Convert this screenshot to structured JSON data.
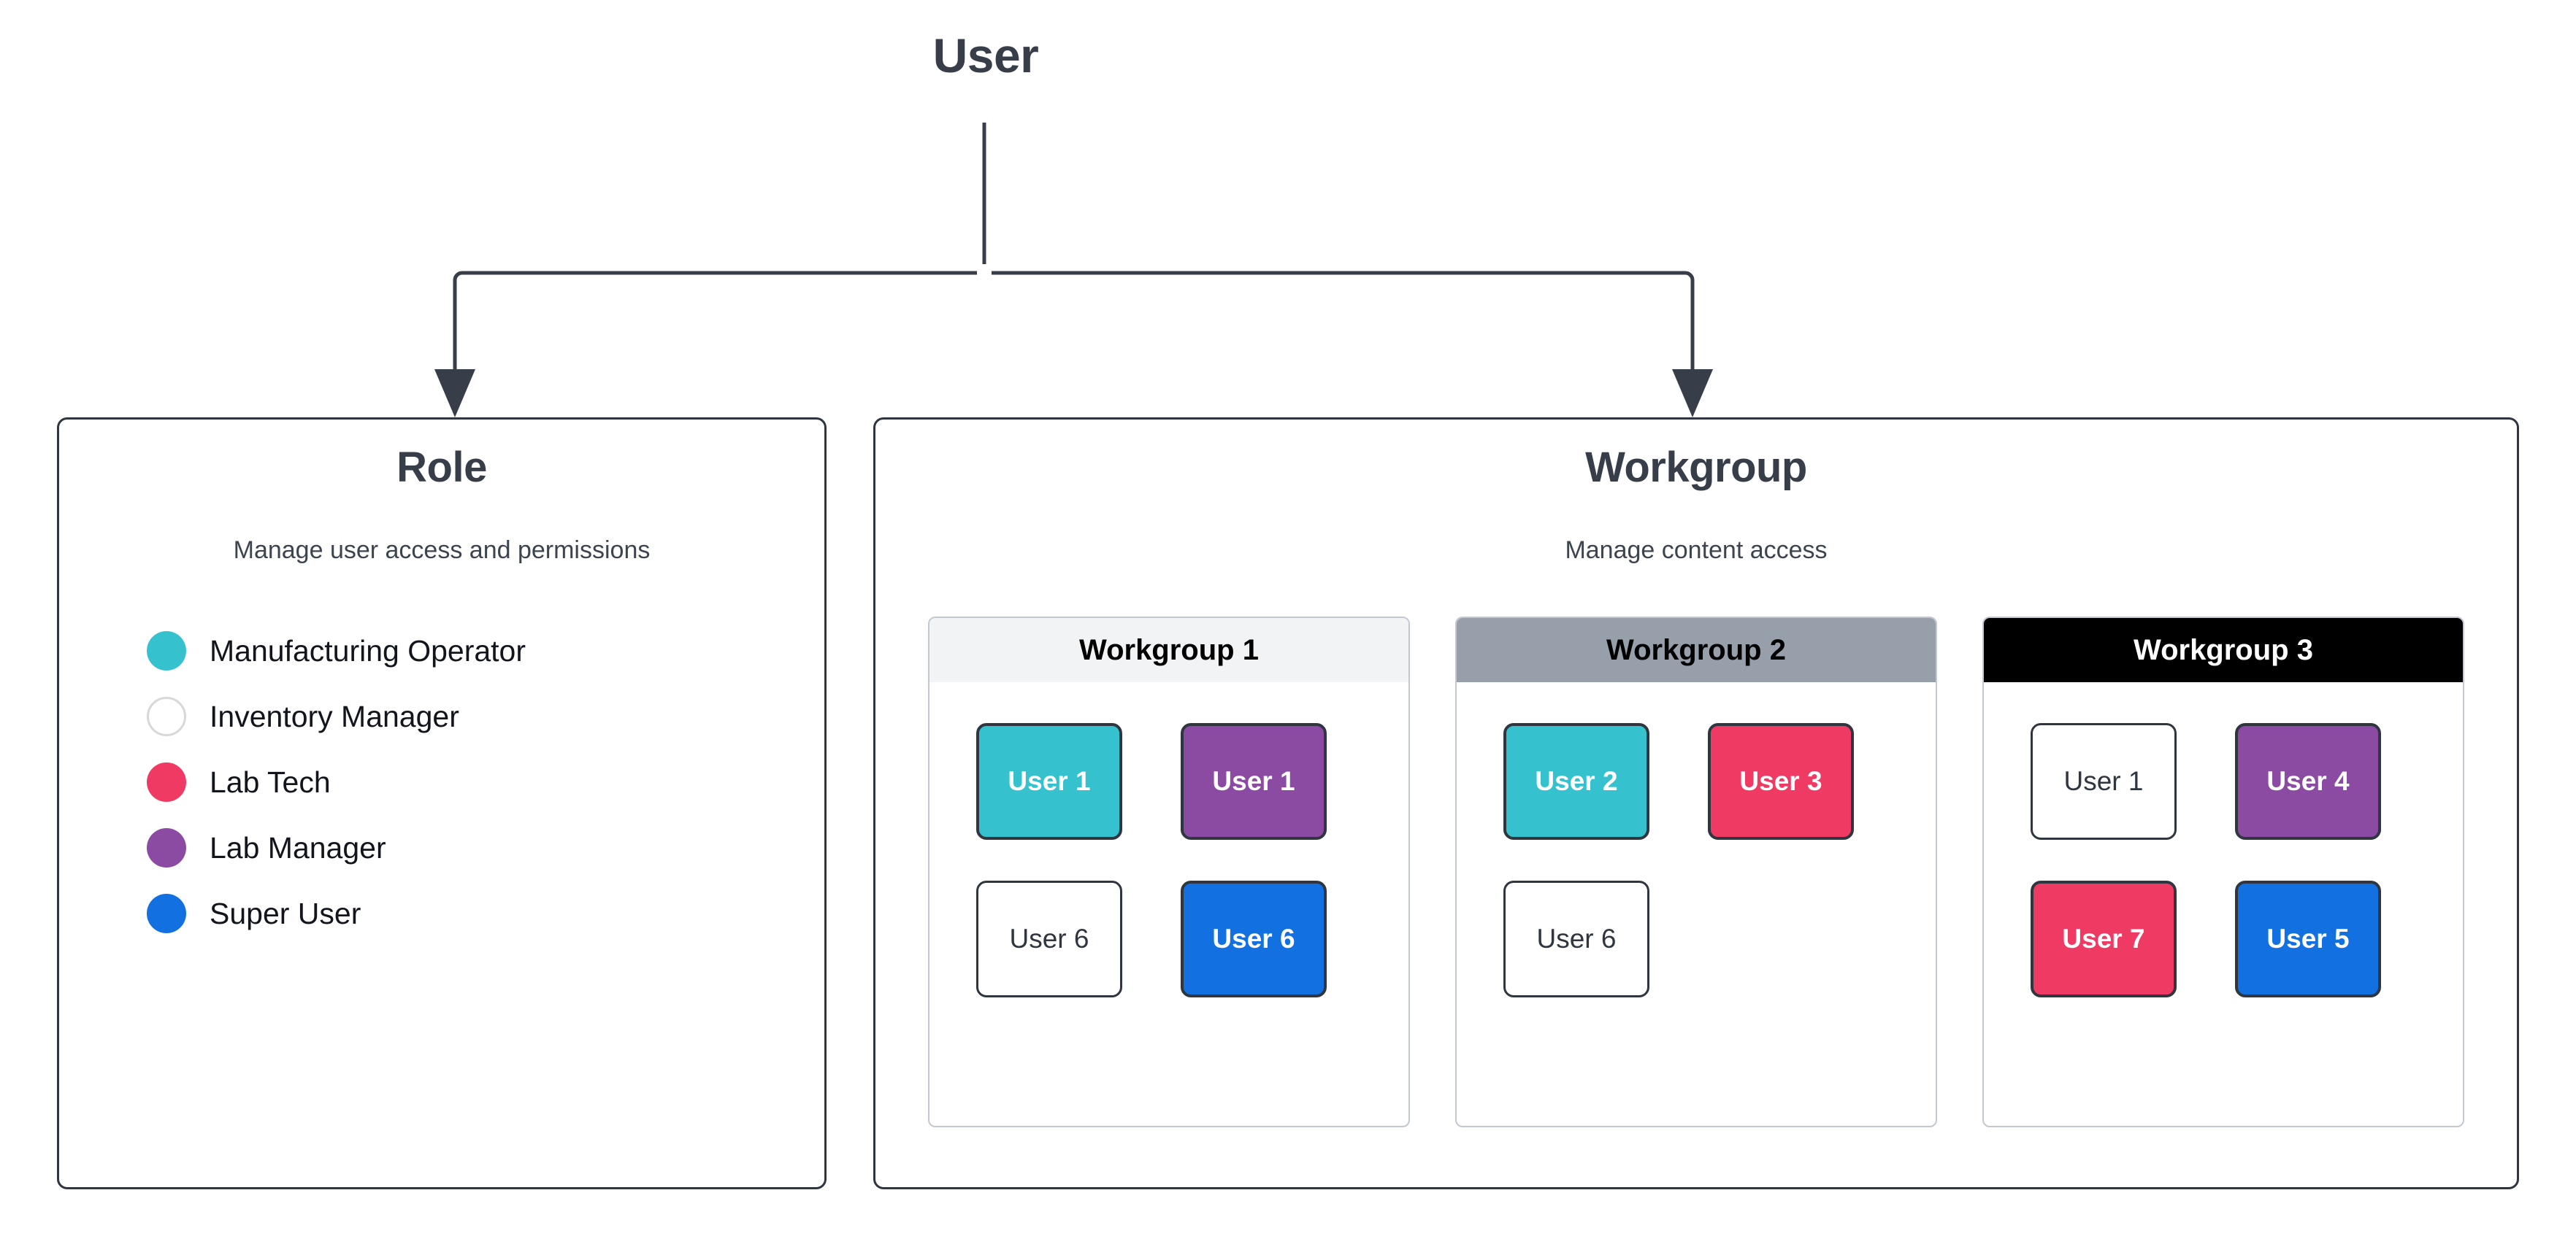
{
  "diagram": {
    "root": {
      "label": "User"
    },
    "colors": {
      "teal": "#35c2ce",
      "purple": "#8b4ba3",
      "pink": "#ef3b63",
      "blue": "#1270e0",
      "white": "#ffffff",
      "line": "#373e49",
      "border": "#2f3640",
      "wg1_header_bg": "#f2f3f5",
      "wg2_header_bg": "#979fab",
      "wg3_header_bg": "#000000"
    }
  },
  "role": {
    "title": "Role",
    "subtitle": "Manage user access and permissions",
    "items": [
      {
        "label": "Manufacturing Operator",
        "color": "#35c2ce",
        "hollow": false
      },
      {
        "label": "Inventory Manager",
        "color": "#ffffff",
        "hollow": true
      },
      {
        "label": "Lab Tech",
        "color": "#ef3b63",
        "hollow": false
      },
      {
        "label": "Lab Manager",
        "color": "#8b4ba3",
        "hollow": false
      },
      {
        "label": "Super User",
        "color": "#1270e0",
        "hollow": false
      }
    ]
  },
  "workgroup": {
    "title": "Workgroup",
    "subtitle": "Manage content access",
    "groups": [
      {
        "name": "Workgroup 1",
        "header_bg": "#f2f3f5",
        "header_fg": "#000000",
        "users": [
          {
            "label": "User 1",
            "color": "#35c2ce",
            "plain": false
          },
          {
            "label": "User 1",
            "color": "#8b4ba3",
            "plain": false
          },
          {
            "label": "User 6",
            "color": "#ffffff",
            "plain": true
          },
          {
            "label": "User 6",
            "color": "#1270e0",
            "plain": false
          }
        ]
      },
      {
        "name": "Workgroup 2",
        "header_bg": "#979fab",
        "header_fg": "#000000",
        "users": [
          {
            "label": "User 2",
            "color": "#35c2ce",
            "plain": false
          },
          {
            "label": "User 3",
            "color": "#ef3b63",
            "plain": false
          },
          {
            "label": "User 6",
            "color": "#ffffff",
            "plain": true
          }
        ]
      },
      {
        "name": "Workgroup 3",
        "header_bg": "#000000",
        "header_fg": "#ffffff",
        "users": [
          {
            "label": "User 1",
            "color": "#ffffff",
            "plain": true
          },
          {
            "label": "User 4",
            "color": "#8b4ba3",
            "plain": false
          },
          {
            "label": "User 7",
            "color": "#ef3b63",
            "plain": false
          },
          {
            "label": "User 5",
            "color": "#1270e0",
            "plain": false
          }
        ]
      }
    ]
  }
}
